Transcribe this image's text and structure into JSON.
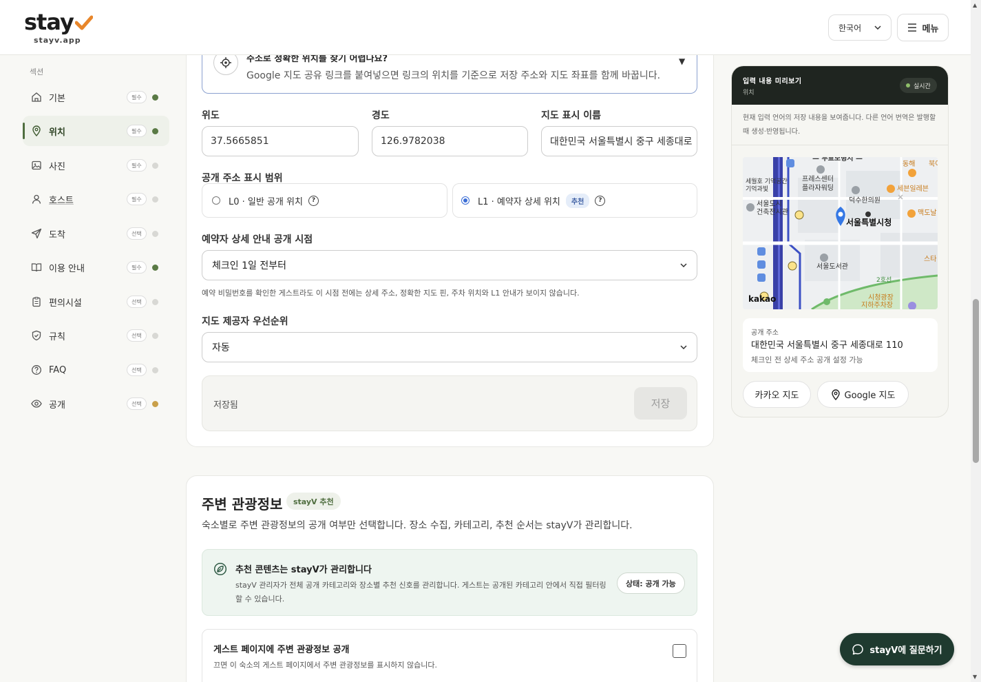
{
  "header": {
    "logo_text": "stay",
    "logo_sub": "stayv.app",
    "language": "한국어",
    "menu_label": "메뉴"
  },
  "sidebar": {
    "title": "섹션",
    "items": [
      {
        "label": "기본",
        "badge": "필수",
        "dot": "#5a7a45"
      },
      {
        "label": "위치",
        "badge": "필수",
        "dot": "#5a7a45"
      },
      {
        "label": "사진",
        "badge": "필수",
        "dot": "#d8d8d4"
      },
      {
        "label": "호스트",
        "badge": "필수",
        "dot": "#d8d8d4"
      },
      {
        "label": "도착",
        "badge": "선택",
        "dot": "#d8d8d4"
      },
      {
        "label": "이용 안내",
        "badge": "필수",
        "dot": "#5a7a45"
      },
      {
        "label": "편의시설",
        "badge": "선택",
        "dot": "#d8d8d4"
      },
      {
        "label": "규칙",
        "badge": "선택",
        "dot": "#d8d8d4"
      },
      {
        "label": "FAQ",
        "badge": "선택",
        "dot": "#d8d8d4"
      },
      {
        "label": "공개",
        "badge": "선택",
        "dot": "#c9a04a"
      }
    ]
  },
  "location": {
    "hint_title": "주소로 정확한 위치를 찾기 어렵나요?",
    "hint_desc": "Google 지도 공유 링크를 붙여넣으면 링크의 위치를 기준으로 저장 주소와 지도 좌표를 함께 바꿉니다.",
    "lat_label": "위도",
    "lat_value": "37.5665851",
    "lng_label": "경도",
    "lng_value": "126.9782038",
    "map_name_label": "지도 표시 이름",
    "map_name_value": "대한민국 서울특별시 중구 세종대로",
    "scope_label": "공개 주소 표시 범위",
    "scope_l0": "L0 · 일반 공개 위치",
    "scope_l1": "L1 · 예약자 상세 위치",
    "scope_l1_badge": "추천",
    "timing_label": "예약자 상세 안내 공개 시점",
    "timing_value": "체크인 1일 전부터",
    "timing_note": "예약 비밀번호를 확인한 게스트라도 이 시점 전에는 상세 주소, 정확한 지도 핀, 주차 위치와 L1 안내가 보이지 않습니다.",
    "provider_label": "지도 제공자 우선순위",
    "provider_value": "자동",
    "save_status": "저장됨",
    "save_label": "저장"
  },
  "tourism": {
    "title": "주변 관광정보",
    "badge": "stayV 추천",
    "desc": "숙소별로 주변 관광정보의 공개 여부만 선택합니다. 장소 수집, 카테고리, 추천 순서는 stayV가 관리합니다.",
    "info_title": "추천 콘텐츠는 stayV가 관리합니다",
    "info_desc": "stayV 관리자가 전체 공개 카테고리와 장소별 추천 신호를 관리합니다. 게스트는 공개된 카테고리 안에서 직접 필터링할 수 있습니다.",
    "status": "상태: 공개 가능",
    "toggle_title": "게스트 페이지에 주변 관광정보 공개",
    "toggle_desc": "끄면 이 숙소의 게스트 페이지에서 주변 관광정보를 표시하지 않습니다."
  },
  "preview": {
    "title": "입력 내용 미리보기",
    "subtitle": "위치",
    "live": "실시간",
    "note": "현재 입력 언어의 저장 내용을 보여줍니다. 다른 언어 번역은 발행할 때 생성·반영됩니다.",
    "map_labels": {
      "l1": "세월호 기억공간",
      "l2": "기억과빛",
      "l3": "프레스센터",
      "l4": "플라자워딩",
      "l5": "덕수한의원",
      "l6": "서울도시",
      "l7": "건축전시관",
      "l8": "서울특별시청",
      "l9": "서울도서관",
      "l10": "동해",
      "l11": "세븐일레븐",
      "l12": "맥도날",
      "l13": "스타",
      "l14": "시청광장",
      "l15": "지하주차장",
      "l16": "kakao",
      "l17": "북이",
      "l18": "2호선"
    },
    "addr_label": "공개 주소",
    "addr_value": "대한민국 서울특별시 중구 세종대로 110",
    "addr_note": "체크인 전 상세 주소 공개 설정 가능",
    "kakao_btn": "카카오 지도",
    "google_btn": "Google 지도"
  },
  "chat_label": "stayV에 질문하기",
  "colors": {
    "brand_orange": "#e8862a",
    "accent_green": "#4f6e3f",
    "dark": "#1f2520"
  }
}
